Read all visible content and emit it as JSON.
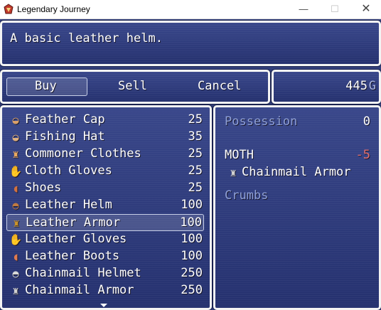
{
  "window": {
    "title": "Legendary Journey",
    "minimize_glyph": "—",
    "maximize_glyph": "☐",
    "close_glyph": "✕"
  },
  "help": {
    "text": "A basic leather helm."
  },
  "commands": {
    "buy": "Buy",
    "sell": "Sell",
    "cancel": "Cancel"
  },
  "gold": {
    "value": "445",
    "unit": "G"
  },
  "items": [
    {
      "name": "Feather Cap",
      "price": "25",
      "icon": "cap-icon",
      "glyph": "◒",
      "color": "#d9a06a"
    },
    {
      "name": "Fishing Hat",
      "price": "35",
      "icon": "hat-icon",
      "glyph": "◒",
      "color": "#e0b080"
    },
    {
      "name": "Commoner Clothes",
      "price": "25",
      "icon": "clothes-icon",
      "glyph": "♜",
      "color": "#e8a860"
    },
    {
      "name": "Cloth Gloves",
      "price": "25",
      "icon": "gloves-icon",
      "glyph": "✋",
      "color": "#f0f0f0"
    },
    {
      "name": "Shoes",
      "price": "25",
      "icon": "shoes-icon",
      "glyph": "◖",
      "color": "#d07040"
    },
    {
      "name": "Leather Helm",
      "price": "100",
      "icon": "helm-icon",
      "glyph": "◓",
      "color": "#c07a40"
    },
    {
      "name": "Leather Armor",
      "price": "100",
      "icon": "armor-icon",
      "glyph": "♜",
      "color": "#c8922a"
    },
    {
      "name": "Leather Gloves",
      "price": "100",
      "icon": "gloves-icon",
      "glyph": "✋",
      "color": "#e08070"
    },
    {
      "name": "Leather Boots",
      "price": "100",
      "icon": "boots-icon",
      "glyph": "◖",
      "color": "#e07a50"
    },
    {
      "name": "Chainmail Helmet",
      "price": "250",
      "icon": "helmet-icon",
      "glyph": "◓",
      "color": "#d8d8d8"
    },
    {
      "name": "Chainmail Armor",
      "price": "250",
      "icon": "armor-icon",
      "glyph": "♜",
      "color": "#d0d0d0"
    }
  ],
  "selected_index": 6,
  "status": {
    "possession_label": "Possession",
    "possession_value": "0",
    "actors": [
      {
        "name": "MOTH",
        "diff": "-5",
        "equip_name": "Chainmail Armor",
        "equip_icon": "armor-icon",
        "equip_glyph": "♜",
        "equip_color": "#d0d0d0"
      },
      {
        "name": "Crumbs"
      }
    ]
  },
  "colors": {
    "window_bg": "#2c3a78",
    "system_text": "#8fa0d8",
    "down_stat": "#e07070",
    "border": "#f3f3f3"
  }
}
